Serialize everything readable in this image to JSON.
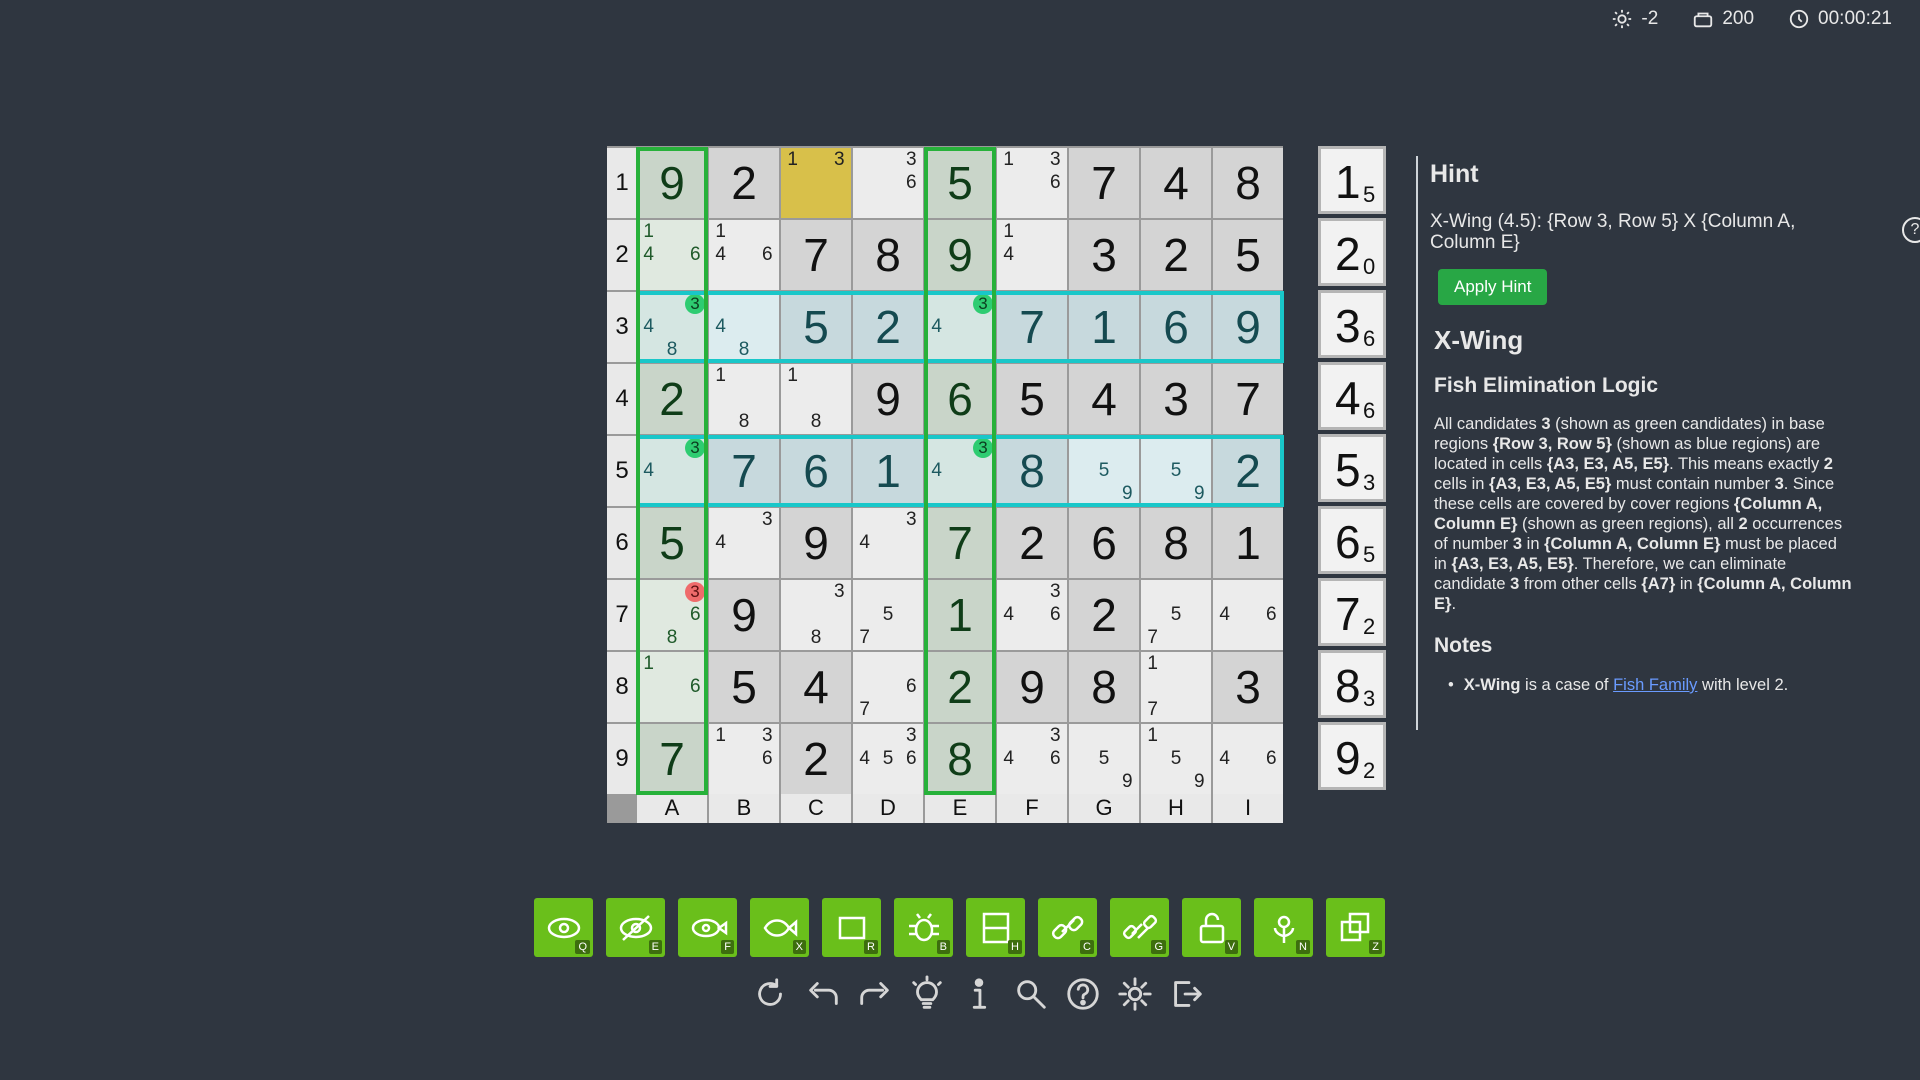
{
  "status": {
    "hint_level": "-2",
    "coins": "200",
    "timer": "00:00:21"
  },
  "board": {
    "row_labels": [
      "1",
      "2",
      "3",
      "4",
      "5",
      "6",
      "7",
      "8",
      "9"
    ],
    "col_labels": [
      "A",
      "B",
      "C",
      "D",
      "E",
      "F",
      "G",
      "H",
      "I"
    ],
    "cells": [
      [
        "9",
        "2",
        [
          1,
          3
        ],
        [
          3,
          6
        ],
        "5",
        [
          1,
          3,
          6
        ],
        "7",
        "4",
        "8"
      ],
      [
        [
          1,
          4,
          6
        ],
        [
          1,
          4,
          6
        ],
        "7",
        "8",
        "9",
        [
          1,
          4
        ],
        "3",
        "2",
        "5"
      ],
      [
        [
          3,
          4,
          8
        ],
        [
          4,
          8
        ],
        "5",
        "2",
        [
          3,
          4
        ],
        "7",
        "1",
        "6",
        "9"
      ],
      [
        "2",
        [
          1,
          8
        ],
        [
          1,
          8
        ],
        "9",
        "6",
        "5",
        "4",
        "3",
        "7"
      ],
      [
        [
          3,
          4
        ],
        "7",
        "6",
        "1",
        [
          3,
          4
        ],
        "8",
        [
          5,
          9
        ],
        [
          5,
          9
        ],
        "2"
      ],
      [
        "5",
        [
          3,
          4
        ],
        "9",
        [
          3,
          4
        ],
        "7",
        "2",
        "6",
        "8",
        "1"
      ],
      [
        [
          3,
          6,
          8
        ],
        "9",
        [
          3,
          8
        ],
        [
          5,
          7
        ],
        "1",
        [
          3,
          4,
          6
        ],
        "2",
        [
          5,
          7
        ],
        [
          4,
          6
        ]
      ],
      [
        [
          1,
          6
        ],
        "5",
        "4",
        [
          6,
          7
        ],
        "2",
        "9",
        "8",
        [
          1,
          7
        ],
        "3"
      ],
      [
        "7",
        [
          1,
          3,
          6
        ],
        "2",
        [
          3,
          4,
          5,
          6
        ],
        "8",
        [
          3,
          4,
          6
        ],
        [
          5,
          9
        ],
        [
          1,
          5,
          9
        ],
        [
          4,
          6
        ]
      ]
    ],
    "highlight_candidates": {
      "green": [
        "A3",
        "E3",
        "A5",
        "E5"
      ],
      "red": [
        "A7"
      ],
      "digit": 3
    },
    "selected_cell": "C1"
  },
  "counts": [
    {
      "n": "1",
      "c": "5"
    },
    {
      "n": "2",
      "c": "0"
    },
    {
      "n": "3",
      "c": "6"
    },
    {
      "n": "4",
      "c": "6"
    },
    {
      "n": "5",
      "c": "3"
    },
    {
      "n": "6",
      "c": "5"
    },
    {
      "n": "7",
      "c": "2"
    },
    {
      "n": "8",
      "c": "3"
    },
    {
      "n": "9",
      "c": "2"
    }
  ],
  "hint": {
    "title": "Hint",
    "line": "X-Wing (4.5): {Row 3, Row 5} X {Column A, Column E}",
    "help_icon": "?",
    "apply_label": "Apply Hint",
    "technique": "X-Wing",
    "subtitle": "Fish Elimination Logic",
    "desc": {
      "p1": "All candidates ",
      "b1": "3",
      "p2": " (shown as green candidates) in base regions ",
      "b2": "{Row 3, Row 5}",
      "p3": " (shown as blue regions) are located in cells ",
      "b3": "{A3, E3, A5, E5}",
      "p4": ". This means exactly ",
      "b4": "2",
      "p5": " cells in ",
      "b5": "{A3, E3, A5, E5}",
      "p6": " must contain number ",
      "b6": "3",
      "p7": ". Since these cells are covered by cover regions ",
      "b7": "{Column A, Column E}",
      "p8": " (shown as green regions), all ",
      "b8": "2",
      "p9": " occurrences of number ",
      "b9": "3",
      "p10": " in ",
      "b10": "{Column A, Column E}",
      "p11": " must be placed in ",
      "b11": "{A3, E3, A5, E5}",
      "p12": ". Therefore, we can eliminate candidate ",
      "b12": "3",
      "p13": " from other cells ",
      "b13": "{A7}",
      "p14": " in ",
      "b14": "{Column A, Column E}",
      "p15": "."
    },
    "notes_title": "Notes",
    "note_bold": "X-Wing",
    "note_text": " is a case of ",
    "note_link": "Fish Family",
    "note_tail": " with level 2."
  },
  "tools": [
    {
      "name": "eye",
      "key": "Q"
    },
    {
      "name": "eye-off",
      "key": "E"
    },
    {
      "name": "eye-fish",
      "key": "F"
    },
    {
      "name": "fish",
      "key": "X"
    },
    {
      "name": "rectangle",
      "key": "R"
    },
    {
      "name": "bug",
      "key": "B"
    },
    {
      "name": "house",
      "key": "H"
    },
    {
      "name": "chain",
      "key": "C"
    },
    {
      "name": "chain-group",
      "key": "G"
    },
    {
      "name": "unlock",
      "key": "V"
    },
    {
      "name": "flower",
      "key": "N"
    },
    {
      "name": "copy",
      "key": "Z"
    }
  ],
  "actions": [
    "restart-icon",
    "undo-icon",
    "redo-icon",
    "lightbulb-icon",
    "info-icon",
    "search-icon",
    "help-icon",
    "gear-icon",
    "exit-icon"
  ],
  "colors": {
    "green": "#27b13a",
    "teal": "#19c7c9",
    "accent": "#6abf1b",
    "selected": "#d8c04a"
  }
}
